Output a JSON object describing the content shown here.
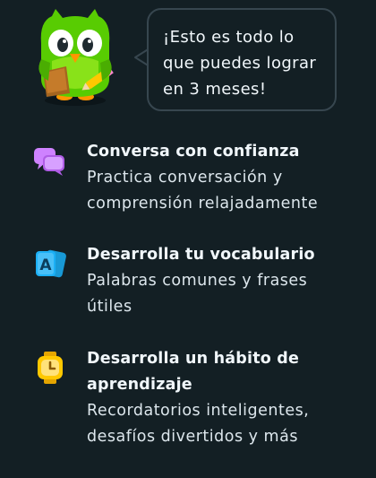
{
  "bubble": {
    "text": "¡Esto es todo lo que puedes lograr en 3 meses!"
  },
  "features": [
    {
      "icon": "chat-bubbles-icon",
      "title": "Conversa con confianza",
      "description": "Practica conversación y comprensión relajadamente"
    },
    {
      "icon": "vocabulary-cards-icon",
      "title": "Desarrolla tu vocabulario",
      "description": "Palabras comunes y frases útiles"
    },
    {
      "icon": "watch-icon",
      "title": "Desarrolla un hábito de aprendizaje",
      "description": "Recordatorios inteligentes, desafíos divertidos y más"
    }
  ],
  "colors": {
    "background": "#131f24",
    "bubble_border": "#37464f",
    "mascot_green": "#58cc02",
    "chat_icon": "#ce82ff",
    "cards_icon": "#1cb0f6",
    "watch_icon": "#ffc800"
  }
}
